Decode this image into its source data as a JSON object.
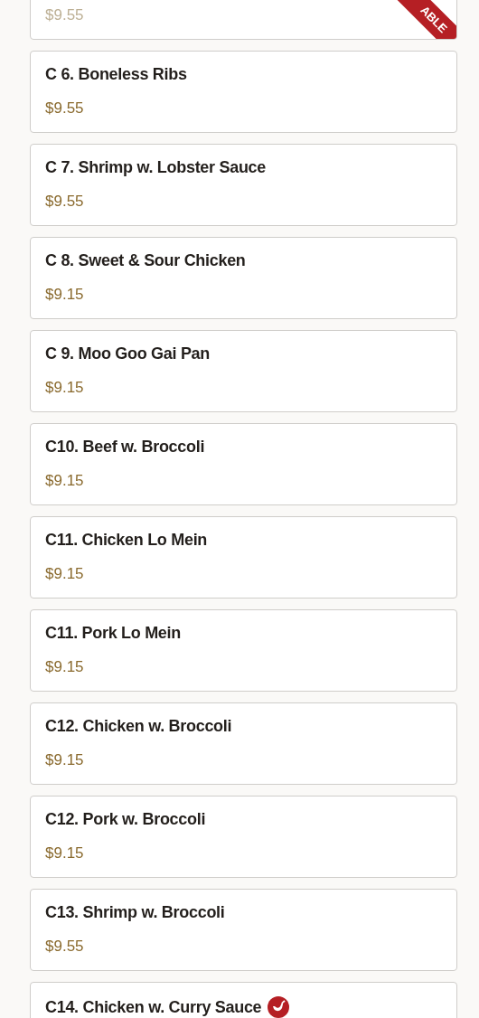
{
  "menu_items": [
    {
      "price": "$9.55",
      "available": false,
      "ribbon": "ABLE",
      "spicy": false
    },
    {
      "name": "C 6. Boneless Ribs",
      "price": "$9.55",
      "available": true,
      "spicy": false
    },
    {
      "name": "C 7. Shrimp w. Lobster Sauce",
      "price": "$9.55",
      "available": true,
      "spicy": false
    },
    {
      "name": "C 8. Sweet & Sour Chicken",
      "price": "$9.15",
      "available": true,
      "spicy": false
    },
    {
      "name": "C 9. Moo Goo Gai Pan",
      "price": "$9.15",
      "available": true,
      "spicy": false
    },
    {
      "name": "C10. Beef w. Broccoli",
      "price": "$9.15",
      "available": true,
      "spicy": false
    },
    {
      "name": "C11. Chicken Lo Mein",
      "price": "$9.15",
      "available": true,
      "spicy": false
    },
    {
      "name": "C11. Pork Lo Mein",
      "price": "$9.15",
      "available": true,
      "spicy": false
    },
    {
      "name": "C12. Chicken w. Broccoli",
      "price": "$9.15",
      "available": true,
      "spicy": false
    },
    {
      "name": "C12. Pork w. Broccoli",
      "price": "$9.15",
      "available": true,
      "spicy": false
    },
    {
      "name": "C13. Shrimp w. Broccoli",
      "price": "$9.55",
      "available": true,
      "spicy": false
    },
    {
      "name": "C14. Chicken w. Curry Sauce",
      "available": true,
      "spicy": true
    }
  ]
}
